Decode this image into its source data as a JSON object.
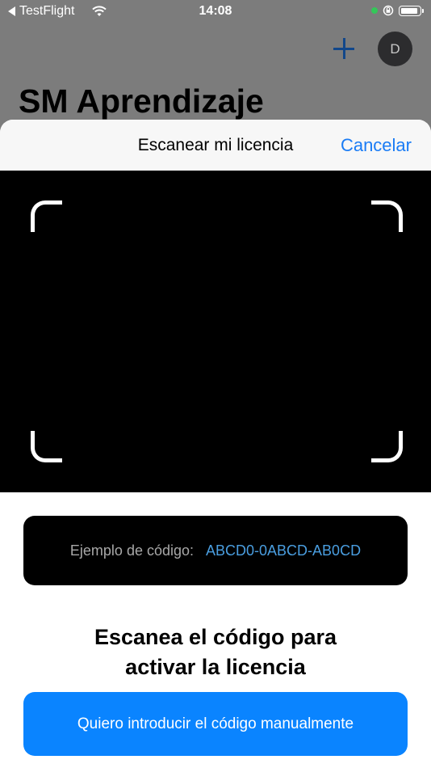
{
  "status_bar": {
    "back_label": "TestFlight",
    "time": "14:08"
  },
  "background": {
    "title": "SM Aprendizaje",
    "avatar_initial": "D"
  },
  "sheet": {
    "title": "Escanear mi licencia",
    "cancel_label": "Cancelar",
    "example_label": "Ejemplo de código:",
    "example_code": "ABCD0-0ABCD-AB0CD",
    "instruction_line1": "Escanea el código para",
    "instruction_line2": "activar la licencia",
    "manual_button_label": "Quiero introducir el código manualmente"
  },
  "colors": {
    "accent": "#1a7cf5",
    "button": "#0a84ff",
    "example_code": "#4a9ee0",
    "camera": "#000000"
  },
  "icons": [
    "back-arrow-icon",
    "wifi-icon",
    "camera-indicator-icon",
    "orientation-lock-icon",
    "battery-icon",
    "plus-icon"
  ]
}
